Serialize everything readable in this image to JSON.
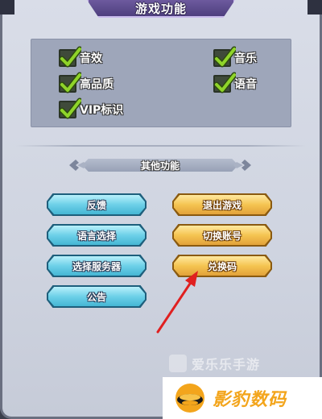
{
  "header": {
    "title": "游戏功能"
  },
  "settings": {
    "options": [
      {
        "label": "音效",
        "checked": true
      },
      {
        "label": "音乐",
        "checked": true
      },
      {
        "label": "高品质",
        "checked": true
      },
      {
        "label": "语音",
        "checked": true
      },
      {
        "label": "VIP标识",
        "checked": true
      }
    ]
  },
  "other": {
    "title": "其他功能",
    "buttons": {
      "feedback": "反馈",
      "exit_game": "退出游戏",
      "language": "语言选择",
      "switch_account": "切换账号",
      "server_select": "选择服务器",
      "redeem_code": "兑换码",
      "announcement": "公告"
    }
  },
  "watermark": {
    "text": "爱乐乐手游"
  },
  "logo": {
    "text": "影豹数码"
  },
  "colors": {
    "blue_button": "#6dd0e8",
    "gold_button": "#f5c451",
    "arrow": "#e02020",
    "check": "#7bc41e"
  }
}
